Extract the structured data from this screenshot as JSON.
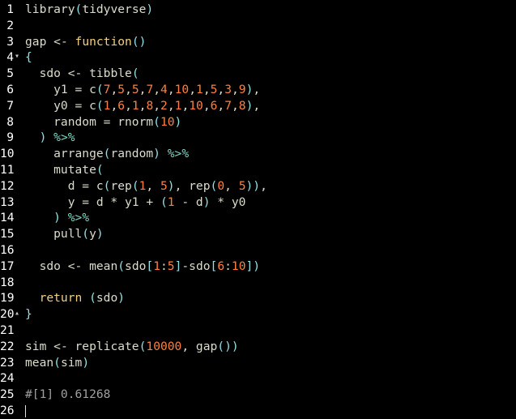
{
  "editor": {
    "language": "R",
    "theme_colors": {
      "background": "#000000",
      "text": "#dcdccc",
      "line_number": "#ffffff",
      "function_keyword": "#f0d080",
      "number": "#ff8040",
      "paren": "#93e0e3",
      "pipe_operator": "#7fd4c1",
      "comment": "#a0a0a0"
    },
    "lines": [
      {
        "n": "1",
        "fold": "",
        "tokens": [
          {
            "t": "library",
            "c": "fn"
          },
          {
            "t": "(",
            "c": "paren"
          },
          {
            "t": "tidyverse",
            "c": "plain"
          },
          {
            "t": ")",
            "c": "paren"
          }
        ]
      },
      {
        "n": "2",
        "fold": "",
        "tokens": []
      },
      {
        "n": "3",
        "fold": "",
        "tokens": [
          {
            "t": "gap ",
            "c": "plain"
          },
          {
            "t": "<-",
            "c": "op"
          },
          {
            "t": " ",
            "c": "plain"
          },
          {
            "t": "function",
            "c": "kw"
          },
          {
            "t": "()",
            "c": "paren"
          }
        ]
      },
      {
        "n": "4",
        "fold": "▾",
        "tokens": [
          {
            "t": "{",
            "c": "paren"
          }
        ]
      },
      {
        "n": "5",
        "fold": "",
        "tokens": [
          {
            "t": "  sdo ",
            "c": "plain"
          },
          {
            "t": "<-",
            "c": "op"
          },
          {
            "t": " tibble",
            "c": "fn"
          },
          {
            "t": "(",
            "c": "paren"
          }
        ]
      },
      {
        "n": "6",
        "fold": "",
        "tokens": [
          {
            "t": "    y1 = c",
            "c": "plain"
          },
          {
            "t": "(",
            "c": "paren"
          },
          {
            "t": "7",
            "c": "num"
          },
          {
            "t": ",",
            "c": "plain"
          },
          {
            "t": "5",
            "c": "num"
          },
          {
            "t": ",",
            "c": "plain"
          },
          {
            "t": "5",
            "c": "num"
          },
          {
            "t": ",",
            "c": "plain"
          },
          {
            "t": "7",
            "c": "num"
          },
          {
            "t": ",",
            "c": "plain"
          },
          {
            "t": "4",
            "c": "num"
          },
          {
            "t": ",",
            "c": "plain"
          },
          {
            "t": "10",
            "c": "num"
          },
          {
            "t": ",",
            "c": "plain"
          },
          {
            "t": "1",
            "c": "num"
          },
          {
            "t": ",",
            "c": "plain"
          },
          {
            "t": "5",
            "c": "num"
          },
          {
            "t": ",",
            "c": "plain"
          },
          {
            "t": "3",
            "c": "num"
          },
          {
            "t": ",",
            "c": "plain"
          },
          {
            "t": "9",
            "c": "num"
          },
          {
            "t": ")",
            "c": "paren"
          },
          {
            "t": ",",
            "c": "plain"
          }
        ]
      },
      {
        "n": "7",
        "fold": "",
        "tokens": [
          {
            "t": "    y0 = c",
            "c": "plain"
          },
          {
            "t": "(",
            "c": "paren"
          },
          {
            "t": "1",
            "c": "num"
          },
          {
            "t": ",",
            "c": "plain"
          },
          {
            "t": "6",
            "c": "num"
          },
          {
            "t": ",",
            "c": "plain"
          },
          {
            "t": "1",
            "c": "num"
          },
          {
            "t": ",",
            "c": "plain"
          },
          {
            "t": "8",
            "c": "num"
          },
          {
            "t": ",",
            "c": "plain"
          },
          {
            "t": "2",
            "c": "num"
          },
          {
            "t": ",",
            "c": "plain"
          },
          {
            "t": "1",
            "c": "num"
          },
          {
            "t": ",",
            "c": "plain"
          },
          {
            "t": "10",
            "c": "num"
          },
          {
            "t": ",",
            "c": "plain"
          },
          {
            "t": "6",
            "c": "num"
          },
          {
            "t": ",",
            "c": "plain"
          },
          {
            "t": "7",
            "c": "num"
          },
          {
            "t": ",",
            "c": "plain"
          },
          {
            "t": "8",
            "c": "num"
          },
          {
            "t": ")",
            "c": "paren"
          },
          {
            "t": ",",
            "c": "plain"
          }
        ]
      },
      {
        "n": "8",
        "fold": "",
        "tokens": [
          {
            "t": "    random = rnorm",
            "c": "plain"
          },
          {
            "t": "(",
            "c": "paren"
          },
          {
            "t": "10",
            "c": "num"
          },
          {
            "t": ")",
            "c": "paren"
          }
        ]
      },
      {
        "n": "9",
        "fold": "",
        "tokens": [
          {
            "t": "  ",
            "c": "plain"
          },
          {
            "t": ")",
            "c": "paren"
          },
          {
            "t": " ",
            "c": "plain"
          },
          {
            "t": "%>%",
            "c": "pipe"
          }
        ]
      },
      {
        "n": "10",
        "fold": "",
        "tokens": [
          {
            "t": "    arrange",
            "c": "plain"
          },
          {
            "t": "(",
            "c": "paren"
          },
          {
            "t": "random",
            "c": "plain"
          },
          {
            "t": ")",
            "c": "paren"
          },
          {
            "t": " ",
            "c": "plain"
          },
          {
            "t": "%>%",
            "c": "pipe"
          }
        ]
      },
      {
        "n": "11",
        "fold": "",
        "tokens": [
          {
            "t": "    mutate",
            "c": "plain"
          },
          {
            "t": "(",
            "c": "paren"
          }
        ]
      },
      {
        "n": "12",
        "fold": "",
        "tokens": [
          {
            "t": "      d = c",
            "c": "plain"
          },
          {
            "t": "(",
            "c": "paren"
          },
          {
            "t": "rep",
            "c": "plain"
          },
          {
            "t": "(",
            "c": "paren"
          },
          {
            "t": "1",
            "c": "num"
          },
          {
            "t": ", ",
            "c": "plain"
          },
          {
            "t": "5",
            "c": "num"
          },
          {
            "t": ")",
            "c": "paren"
          },
          {
            "t": ", rep",
            "c": "plain"
          },
          {
            "t": "(",
            "c": "paren"
          },
          {
            "t": "0",
            "c": "num"
          },
          {
            "t": ", ",
            "c": "plain"
          },
          {
            "t": "5",
            "c": "num"
          },
          {
            "t": "))",
            "c": "paren"
          },
          {
            "t": ",",
            "c": "plain"
          }
        ]
      },
      {
        "n": "13",
        "fold": "",
        "tokens": [
          {
            "t": "      y = d * y1 + ",
            "c": "plain"
          },
          {
            "t": "(",
            "c": "paren"
          },
          {
            "t": "1",
            "c": "num"
          },
          {
            "t": " - d",
            "c": "plain"
          },
          {
            "t": ")",
            "c": "paren"
          },
          {
            "t": " * y0",
            "c": "plain"
          }
        ]
      },
      {
        "n": "14",
        "fold": "",
        "tokens": [
          {
            "t": "    ",
            "c": "plain"
          },
          {
            "t": ")",
            "c": "paren"
          },
          {
            "t": " ",
            "c": "plain"
          },
          {
            "t": "%>%",
            "c": "pipe"
          }
        ]
      },
      {
        "n": "15",
        "fold": "",
        "tokens": [
          {
            "t": "    pull",
            "c": "plain"
          },
          {
            "t": "(",
            "c": "paren"
          },
          {
            "t": "y",
            "c": "plain"
          },
          {
            "t": ")",
            "c": "paren"
          }
        ]
      },
      {
        "n": "16",
        "fold": "",
        "tokens": []
      },
      {
        "n": "17",
        "fold": "",
        "tokens": [
          {
            "t": "  sdo ",
            "c": "plain"
          },
          {
            "t": "<-",
            "c": "op"
          },
          {
            "t": " mean",
            "c": "plain"
          },
          {
            "t": "(",
            "c": "paren"
          },
          {
            "t": "sdo",
            "c": "plain"
          },
          {
            "t": "[",
            "c": "paren"
          },
          {
            "t": "1",
            "c": "num"
          },
          {
            "t": ":",
            "c": "plain"
          },
          {
            "t": "5",
            "c": "num"
          },
          {
            "t": "]",
            "c": "paren"
          },
          {
            "t": "-sdo",
            "c": "plain"
          },
          {
            "t": "[",
            "c": "paren"
          },
          {
            "t": "6",
            "c": "num"
          },
          {
            "t": ":",
            "c": "plain"
          },
          {
            "t": "10",
            "c": "num"
          },
          {
            "t": "])",
            "c": "paren"
          }
        ]
      },
      {
        "n": "18",
        "fold": "",
        "tokens": []
      },
      {
        "n": "19",
        "fold": "",
        "tokens": [
          {
            "t": "  ",
            "c": "plain"
          },
          {
            "t": "return",
            "c": "kw"
          },
          {
            "t": " ",
            "c": "plain"
          },
          {
            "t": "(",
            "c": "paren"
          },
          {
            "t": "sdo",
            "c": "plain"
          },
          {
            "t": ")",
            "c": "paren"
          }
        ]
      },
      {
        "n": "20",
        "fold": "▴",
        "tokens": [
          {
            "t": "}",
            "c": "paren"
          }
        ]
      },
      {
        "n": "21",
        "fold": "",
        "tokens": []
      },
      {
        "n": "22",
        "fold": "",
        "tokens": [
          {
            "t": "sim ",
            "c": "plain"
          },
          {
            "t": "<-",
            "c": "op"
          },
          {
            "t": " replicate",
            "c": "plain"
          },
          {
            "t": "(",
            "c": "paren"
          },
          {
            "t": "10000",
            "c": "num"
          },
          {
            "t": ", gap",
            "c": "plain"
          },
          {
            "t": "())",
            "c": "paren"
          }
        ]
      },
      {
        "n": "23",
        "fold": "",
        "tokens": [
          {
            "t": "mean",
            "c": "plain"
          },
          {
            "t": "(",
            "c": "paren"
          },
          {
            "t": "sim",
            "c": "plain"
          },
          {
            "t": ")",
            "c": "paren"
          }
        ]
      },
      {
        "n": "24",
        "fold": "",
        "tokens": []
      },
      {
        "n": "25",
        "fold": "",
        "tokens": [
          {
            "t": "#[1] 0.61268",
            "c": "comment"
          }
        ]
      },
      {
        "n": "26",
        "fold": "",
        "tokens": []
      }
    ]
  }
}
